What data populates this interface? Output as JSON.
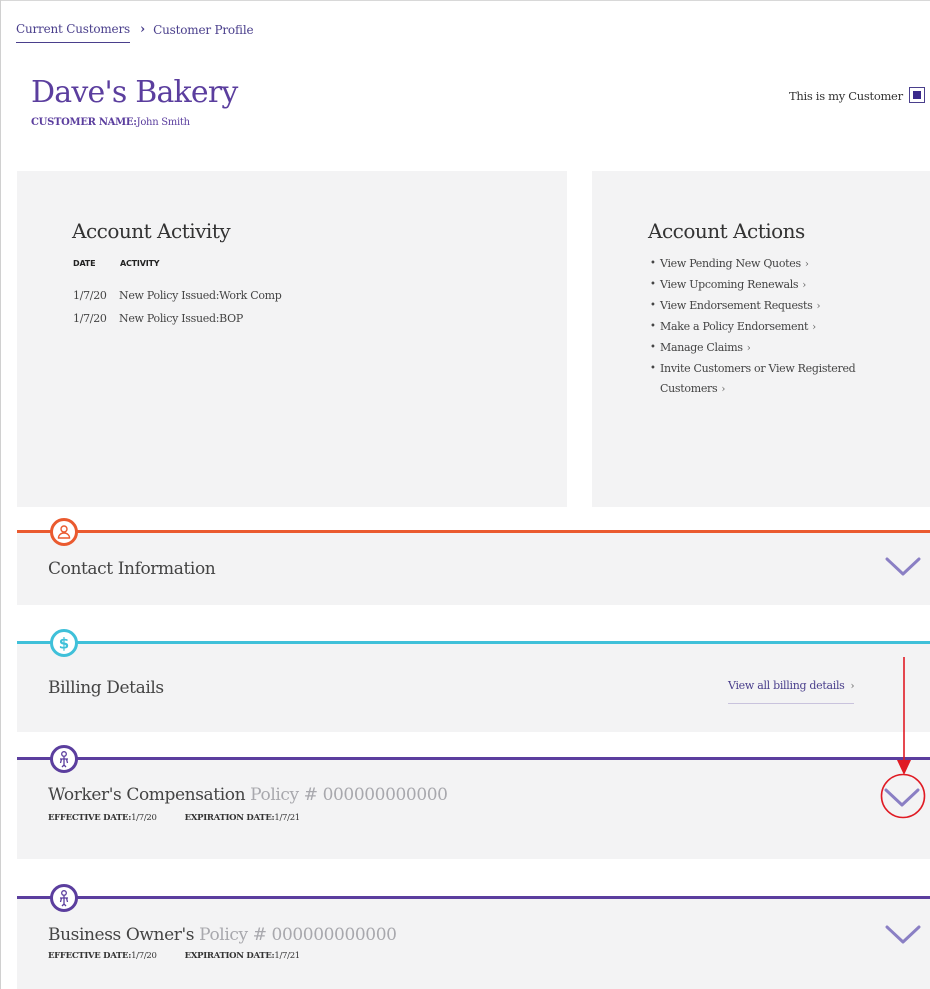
{
  "breadcrumb": {
    "link": "Current Customers",
    "separator": "›",
    "current": "Customer Profile"
  },
  "header": {
    "title": "Dave's Bakery",
    "customer_name_label": "CUSTOMER NAME:",
    "customer_name_value": "John Smith",
    "my_customer_label": "This is my Customer",
    "my_customer_checked": true
  },
  "activity": {
    "heading": "Account Activity",
    "col_date": "DATE",
    "col_activity": "ACTIVITY",
    "rows": [
      {
        "date": "1/7/20",
        "activity": "New Policy Issued:Work Comp"
      },
      {
        "date": "1/7/20",
        "activity": "New Policy Issued:BOP"
      }
    ]
  },
  "actions": {
    "heading": "Account Actions",
    "items": [
      "View Pending New Quotes",
      "View Upcoming Renewals",
      "View Endorsement Requests",
      "Make a Policy Endorsement",
      "Manage Claims",
      "Invite Customers or View Registered Customers"
    ],
    "arrow": "›"
  },
  "sections": {
    "contact": {
      "title": "Contact Information",
      "icon": "user-icon"
    },
    "billing": {
      "title": "Billing Details",
      "icon": "dollar-icon",
      "link": "View all billing details",
      "arrow": "›"
    },
    "workers_comp": {
      "title": "Worker's Compensation",
      "policy": "Policy # 000000000000",
      "effective_label": "EFFECTIVE DATE:",
      "effective_value": "1/7/20",
      "expiration_label": "EXPIRATION DATE:",
      "expiration_value": "1/7/21",
      "icon": "worker-icon"
    },
    "business_owner": {
      "title": "Business Owner's",
      "policy": "Policy # 000000000000",
      "effective_label": "EFFECTIVE DATE:",
      "effective_value": "1/7/20",
      "expiration_label": "EXPIRATION DATE:",
      "expiration_value": "1/7/21",
      "icon": "worker-icon"
    }
  },
  "colors": {
    "brand_purple": "#5b3e9e",
    "contact_accent": "#ea5a2f",
    "billing_accent": "#3fc0d9",
    "policy_accent": "#5b3e9e",
    "annotation_red": "#e01b24",
    "panel_bg": "#f3f3f4"
  }
}
